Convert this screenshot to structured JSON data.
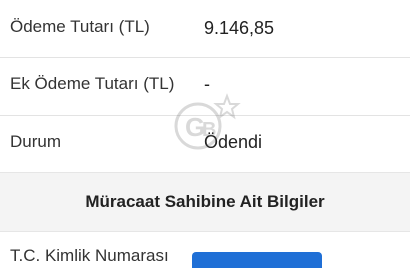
{
  "payment_details": {
    "amount_label": "Ödeme Tutarı (TL)",
    "amount_value": "9.146,85",
    "extra_label": "Ek Ödeme Tutarı (TL)",
    "extra_value": "-",
    "status_label": "Durum",
    "status_value": "Ödendi"
  },
  "applicant_section": {
    "title": "Müracaat Sahibine Ait Bilgiler",
    "tckn_label": "T.C. Kimlik Numarası"
  },
  "colors": {
    "button_blue": "#1f6fd6",
    "section_background": "#f4f4f4"
  },
  "watermark": {
    "icon": "gb-star-watermark-icon"
  }
}
